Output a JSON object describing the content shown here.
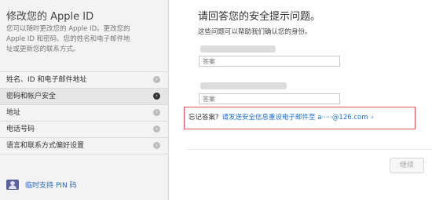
{
  "sidebar": {
    "title": "修改您的 Apple ID",
    "description_lines": [
      "您可以随时更改您的 Apple ID。更改您的",
      "Apple ID 和密码、您的姓名和电子邮件地",
      "址或更新您的联系方式。"
    ],
    "items": [
      {
        "label": "姓名、ID 和电子邮件地址",
        "active": false
      },
      {
        "label": "密码和帐户安全",
        "active": true
      },
      {
        "label": "地址",
        "active": false
      },
      {
        "label": "电话号码",
        "active": false
      },
      {
        "label": "语言和联系方式偏好设置",
        "active": false
      }
    ],
    "pin_label": "临时支持 PIN 码"
  },
  "main": {
    "title": "请回答您的安全提示问题。",
    "subtitle": "这些问题可以帮助我们确认您的身份。",
    "answer1_placeholder": "答案",
    "answer2_placeholder": "答案",
    "forgot_label": "忘记答案?",
    "forgot_link": "请发送安全信息重设电子邮件至 a·····@126.com",
    "forgot_arrow": "›",
    "continue_label": "继续"
  },
  "colors": {
    "link": "#1a6fc8",
    "highlight_border": "#d9534f",
    "pin_icon": "#5b5f9e"
  }
}
